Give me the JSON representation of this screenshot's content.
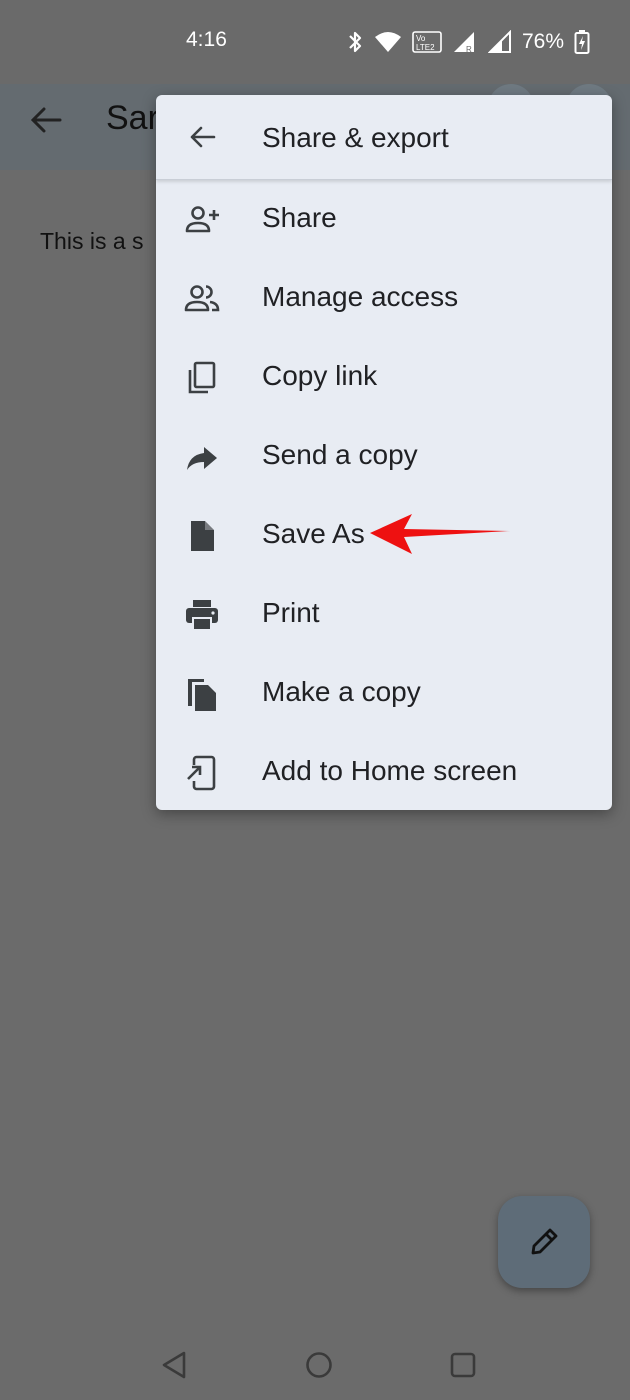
{
  "status_bar": {
    "time": "4:16",
    "battery": "76%",
    "icons": [
      "bluetooth-icon",
      "wifi-icon",
      "volte-icon",
      "signal-icon",
      "signal-roaming-icon",
      "battery-charging-icon"
    ],
    "volte_label": "VoLTE2"
  },
  "app_bar": {
    "doc_title": "Sar"
  },
  "document": {
    "text": "This is a s"
  },
  "menu": {
    "title": "Share & export",
    "back_icon": "arrow-back-icon",
    "items": [
      {
        "label": "Share",
        "icon": "person-add-icon"
      },
      {
        "label": "Manage access",
        "icon": "people-icon"
      },
      {
        "label": "Copy link",
        "icon": "copy-icon"
      },
      {
        "label": "Send a copy",
        "icon": "forward-icon"
      },
      {
        "label": "Save As",
        "icon": "file-icon"
      },
      {
        "label": "Print",
        "icon": "printer-icon"
      },
      {
        "label": "Make a copy",
        "icon": "file-copy-icon"
      },
      {
        "label": "Add to Home screen",
        "icon": "add-to-home-icon"
      }
    ]
  },
  "fab": {
    "icon": "pencil-icon"
  },
  "nav": {
    "icons": [
      "nav-back-icon",
      "nav-home-icon",
      "nav-recents-icon"
    ]
  },
  "colors": {
    "menu_bg": "#e8ecf3",
    "scrim_bg": "#6b6b6b",
    "icon_color": "#3c4043",
    "annotation_red": "#ee1111"
  }
}
